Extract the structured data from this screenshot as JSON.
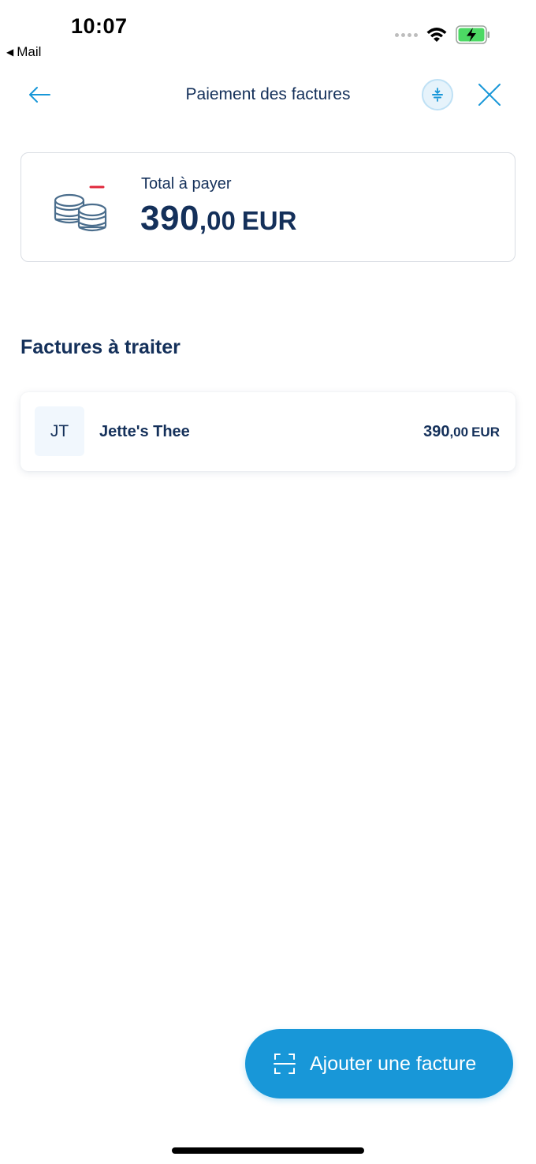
{
  "status_bar": {
    "time": "10:07",
    "back_app": "Mail"
  },
  "header": {
    "title": "Paiement des factures"
  },
  "total": {
    "label": "Total à payer",
    "amount_int": "390",
    "amount_dec": ",00",
    "currency": "EUR"
  },
  "section": {
    "title": "Factures à traiter"
  },
  "invoices": [
    {
      "initials": "JT",
      "name": "Jette's Thee",
      "amount_int": "390",
      "amount_dec": ",00",
      "currency": "EUR"
    }
  ],
  "fab": {
    "label": "Ajouter une facture"
  },
  "colors": {
    "primary": "#1897d8",
    "navy": "#14305a",
    "accent_red": "#e0283c",
    "battery_green": "#4cd964"
  },
  "icons": {
    "back": "arrow-left-icon",
    "help": "help-icon",
    "close": "close-icon",
    "coins": "coins-icon",
    "scan": "scan-icon",
    "wifi": "wifi-icon",
    "battery": "battery-charging-icon"
  }
}
